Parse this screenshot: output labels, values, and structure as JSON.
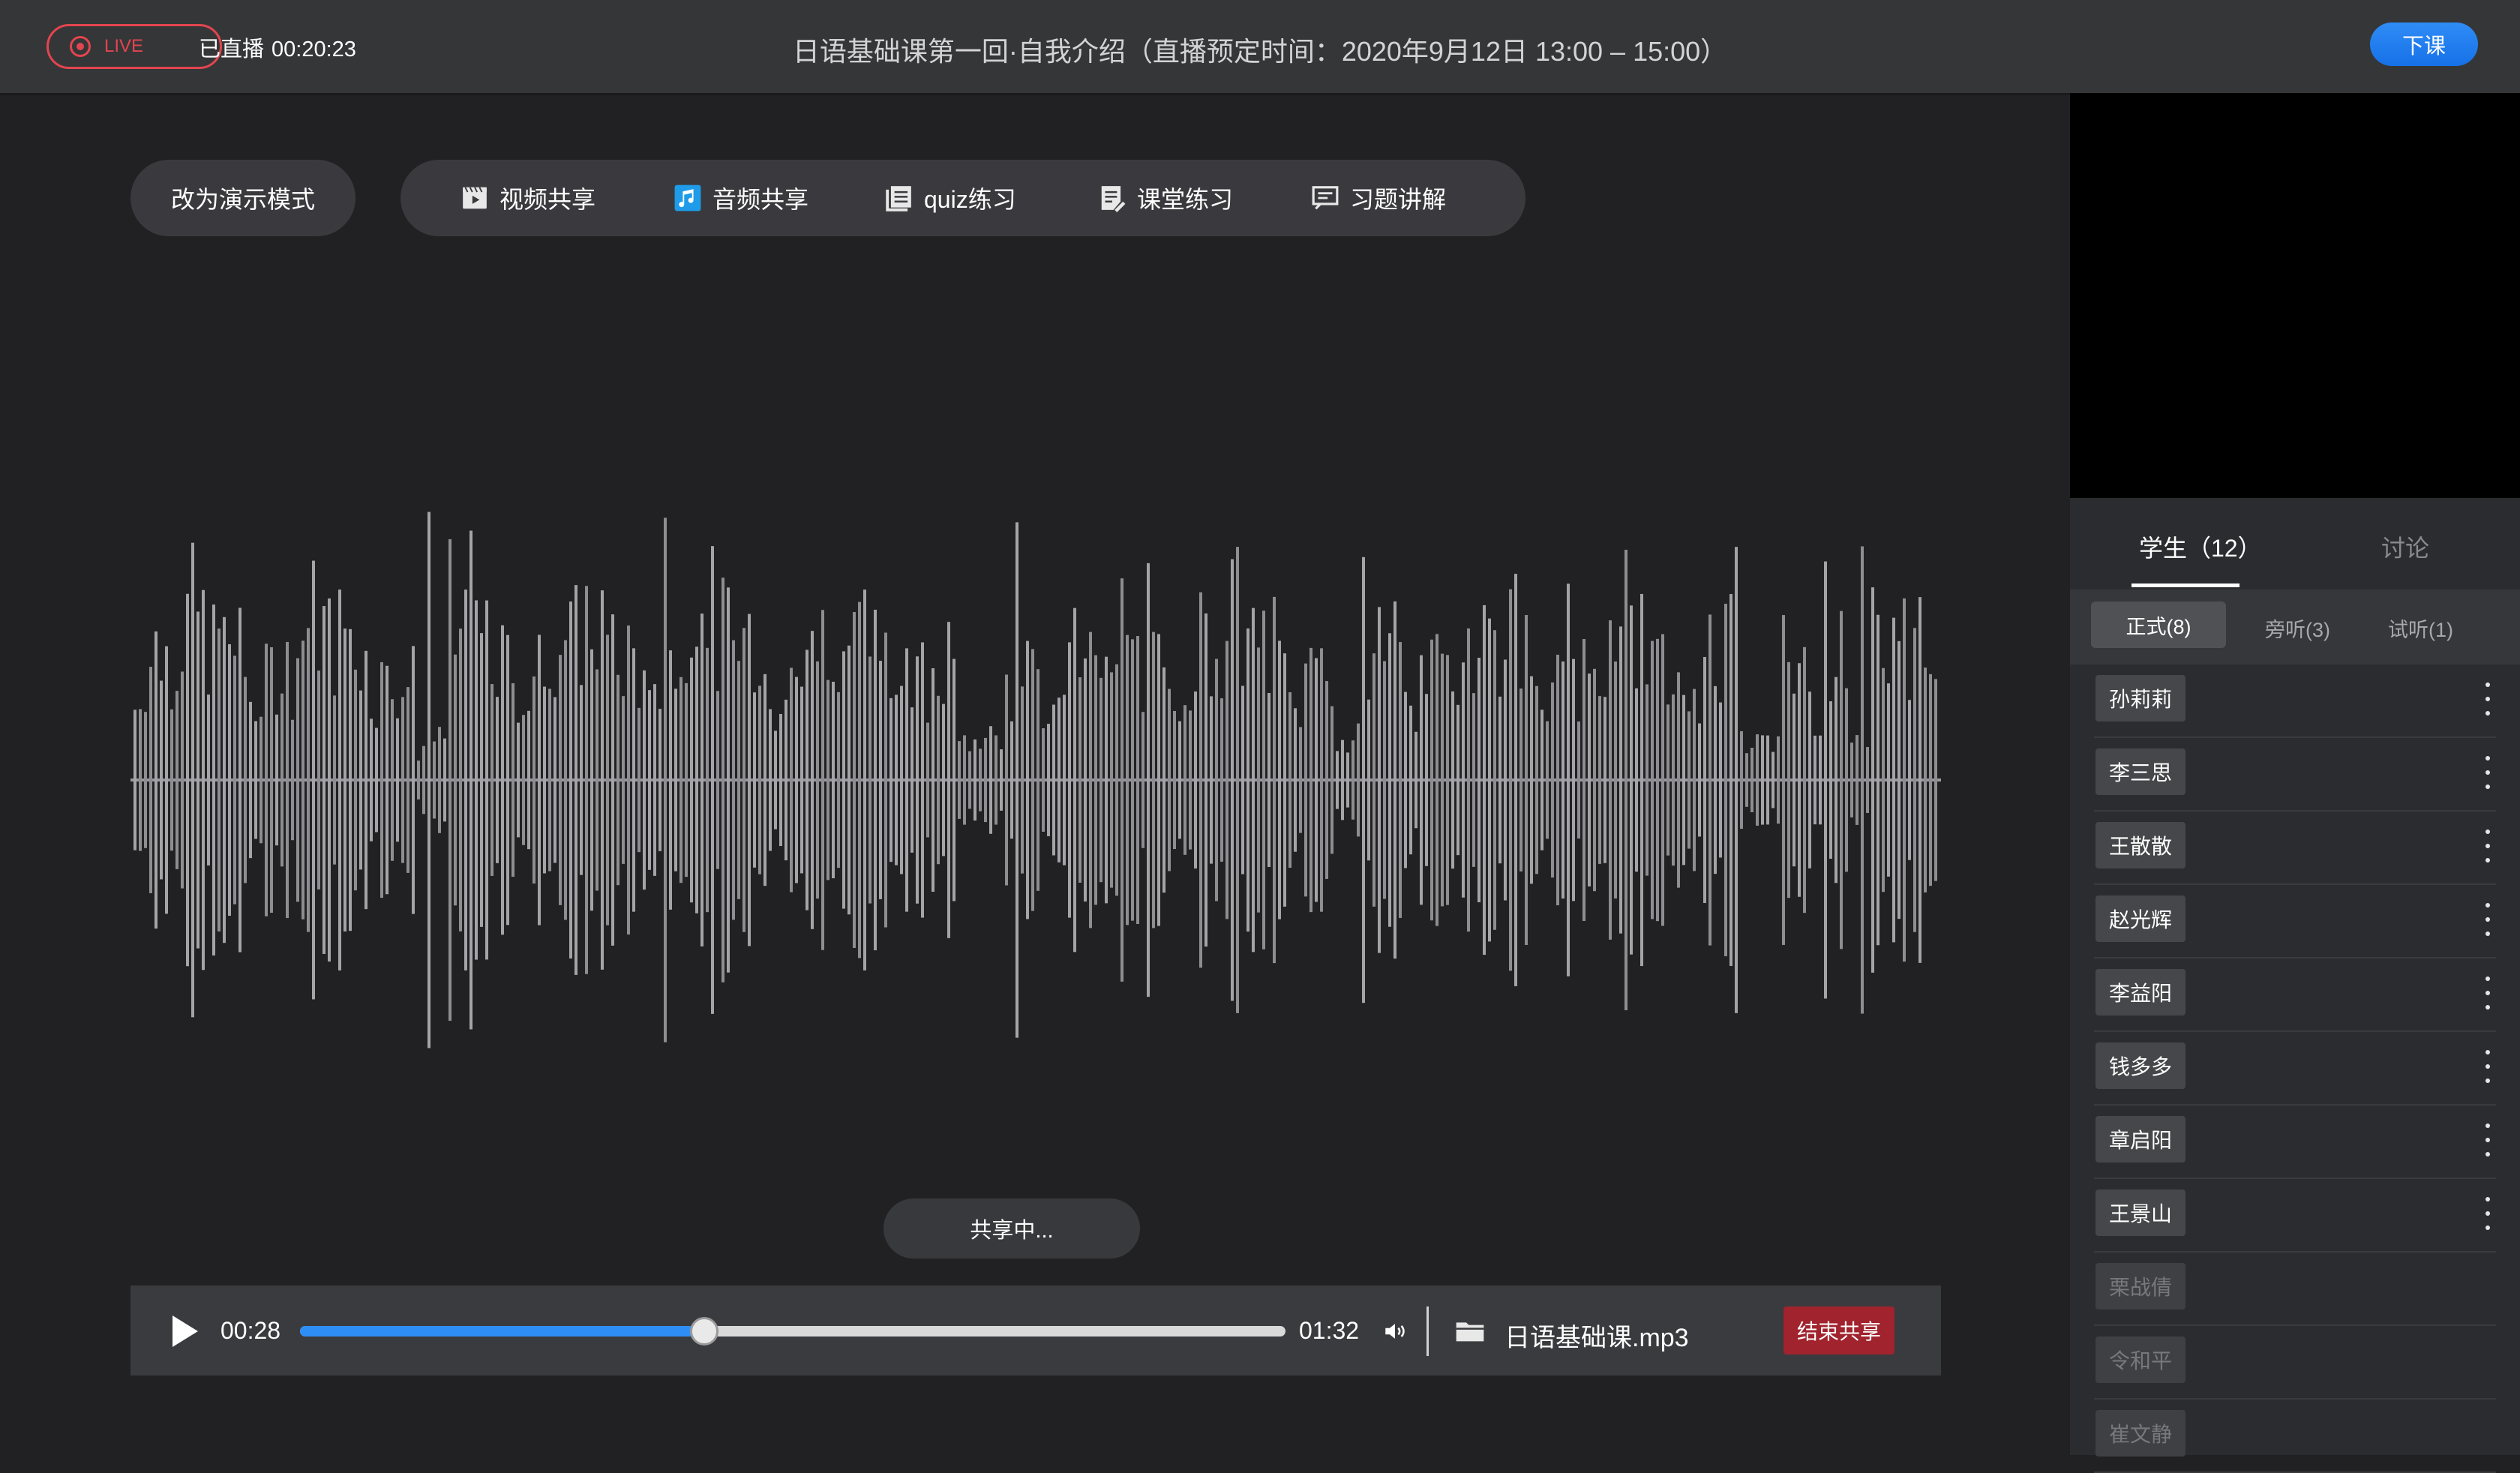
{
  "header": {
    "live_label": "LIVE",
    "elapsed_label": "已直播",
    "elapsed_time": "00:20:23",
    "class_title": "日语基础课第一回·自我介绍（直播预定时间：2020年9月12日 13:00 – 15:00）",
    "end_class_label": "下课"
  },
  "toolbar": {
    "mode_label": "改为演示模式",
    "tools": [
      {
        "label": "视频共享",
        "icon": "video-icon"
      },
      {
        "label": "音频共享",
        "icon": "music-icon"
      },
      {
        "label": "quiz练习",
        "icon": "quiz-icon"
      },
      {
        "label": "课堂练习",
        "icon": "exercise-icon"
      },
      {
        "label": "习题讲解",
        "icon": "explain-icon"
      }
    ]
  },
  "sharing_status": "共享中...",
  "player": {
    "current_time": "00:28",
    "duration": "01:32",
    "progress": 0.41,
    "file_name": "日语基础课.mp3",
    "stop_label": "结束共享"
  },
  "colors": {
    "accent_blue": "#2f8ef5",
    "live_red": "#e2454f",
    "stop_red": "#a0232d"
  },
  "side_panel": {
    "tab_students": "学生（12）",
    "tab_discussion": "讨论",
    "subtabs": [
      "正式(8)",
      "旁听(3)",
      "试听(1)"
    ],
    "students": [
      {
        "name": "孙莉莉",
        "active": true
      },
      {
        "name": "李三思",
        "active": true
      },
      {
        "name": "王散散",
        "active": true
      },
      {
        "name": "赵光辉",
        "active": true
      },
      {
        "name": "李益阳",
        "active": true
      },
      {
        "name": "钱多多",
        "active": true
      },
      {
        "name": "章启阳",
        "active": true
      },
      {
        "name": "王景山",
        "active": true
      },
      {
        "name": "栗战倩",
        "active": false
      },
      {
        "name": "令和平",
        "active": false
      },
      {
        "name": "崔文静",
        "active": false
      }
    ]
  }
}
